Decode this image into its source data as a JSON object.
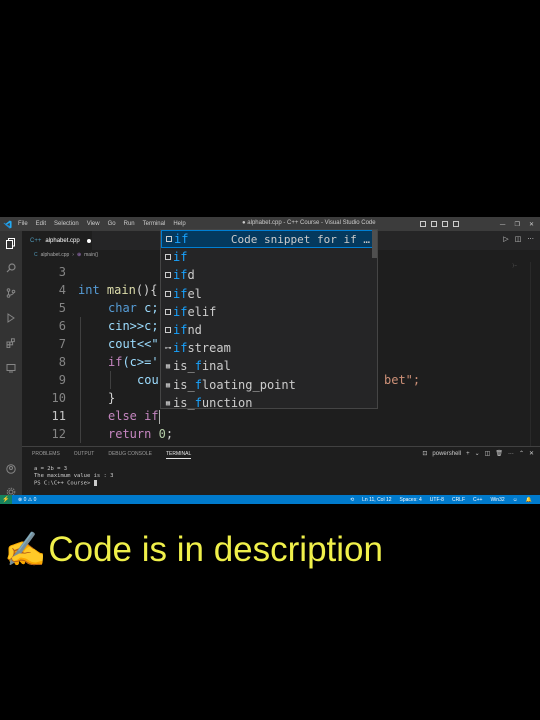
{
  "window": {
    "title": "● alphabet.cpp - C++ Course - Visual Studio Code",
    "menu": [
      "File",
      "Edit",
      "Selection",
      "View",
      "Go",
      "Run",
      "Terminal",
      "Help"
    ]
  },
  "tabs": [
    {
      "label": "alphabet.cpp",
      "icon_text": "C++",
      "modified": true
    }
  ],
  "breadcrumb": {
    "file": "alphabet.cpp",
    "symbol": "main()"
  },
  "editor": {
    "line_numbers": [
      "3",
      "4",
      "5",
      "6",
      "7",
      "8",
      "9",
      "10",
      "11",
      "12"
    ],
    "active_line": "11",
    "minimap_line": "}~"
  },
  "code": {
    "l4_kw": "int",
    "l4_fn": "main",
    "l4_rest": "(){",
    "l5_kw": "char",
    "l5_rest": " c;",
    "l6": "cin>>c;",
    "l7": "cout<<\"",
    "l8_ctl": "if",
    "l8_rest": "(c>='",
    "l9": "cou",
    "l9_str": "bet\";",
    "l10": "}",
    "l11": "else if",
    "l12_ctl": "return",
    "l12_num": "0",
    "l12_rest": ";"
  },
  "suggest": {
    "detail": "Code snippet for if …",
    "items": [
      {
        "match": "if",
        "rest": "",
        "icon": "snippet-icon"
      },
      {
        "match": "if",
        "rest": "",
        "icon": "keyword-icon"
      },
      {
        "match": "if",
        "rest": "d",
        "icon": "snippet-icon"
      },
      {
        "match": "if",
        "rest": "el",
        "icon": "snippet-icon"
      },
      {
        "match": "if",
        "rest": "elif",
        "icon": "snippet-icon"
      },
      {
        "match": "if",
        "rest": "nd",
        "icon": "snippet-icon"
      },
      {
        "match": "if",
        "rest": "stream",
        "icon": "class-icon"
      },
      {
        "pre": "is_",
        "match": "f",
        "rest": "inal",
        "icon": "struct-icon"
      },
      {
        "pre": "is_",
        "match": "f",
        "rest": "loating_point",
        "icon": "struct-icon"
      },
      {
        "pre": "is_",
        "match": "f",
        "rest": "unction",
        "icon": "struct-icon"
      }
    ]
  },
  "panel": {
    "tabs": [
      "PROBLEMS",
      "OUTPUT",
      "DEBUG CONSOLE",
      "TERMINAL"
    ],
    "active_tab": "TERMINAL",
    "shell": "powershell",
    "terminal_lines": [
      "a = 2b = 3",
      "The maximum value is : 3",
      "PS C:\\C++ Course> "
    ]
  },
  "status": {
    "errors": "0",
    "warnings": "0",
    "position": "Ln 11, Col 12",
    "spaces": "Spaces: 4",
    "encoding": "UTF-8",
    "eol": "CRLF",
    "language": "C++",
    "platform": "Win32"
  },
  "caption": {
    "emoji": "✍️",
    "text": "Code is in description",
    "color": "#f0f04a"
  },
  "colors": {
    "accent": "#007acc",
    "keyword": "#569cd6",
    "control": "#c586c0",
    "function": "#dcdcaa",
    "match_highlight": "#18a3ff"
  }
}
